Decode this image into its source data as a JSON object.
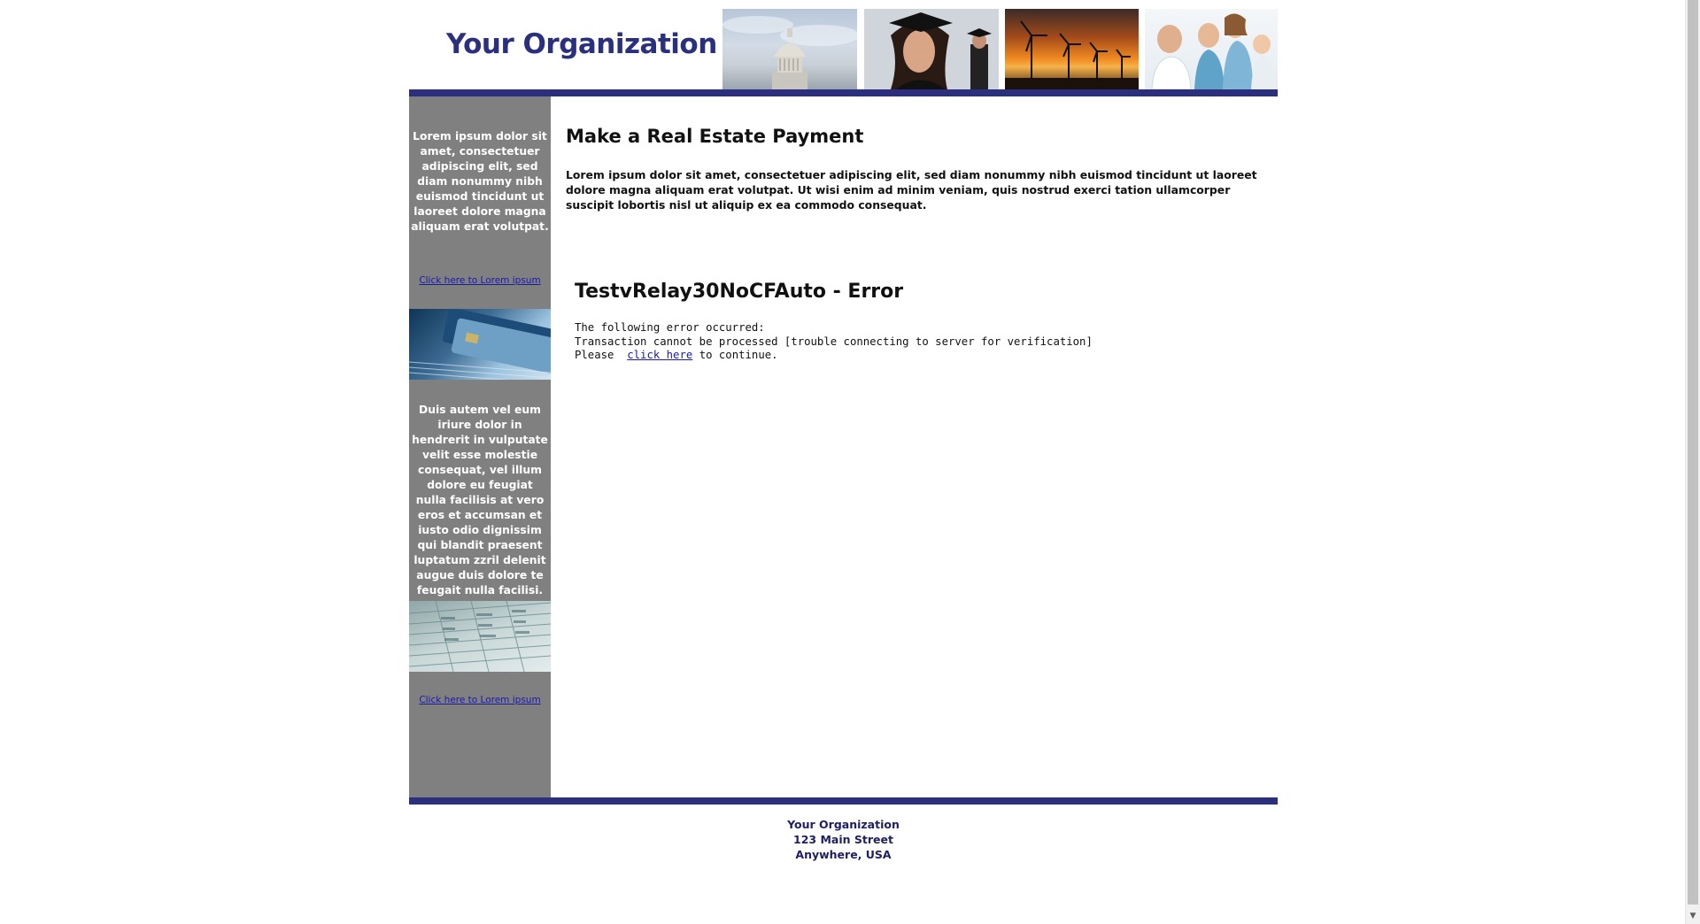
{
  "header": {
    "logo_text": "Your Organization",
    "photos": [
      "capitol-building-photo",
      "graduate-photo",
      "wind-turbines-photo",
      "family-doctor-photo"
    ]
  },
  "sidebar": {
    "text_1": "Lorem ipsum dolor sit amet, consectetuer adipiscing elit, sed diam nonummy nibh euismod tincidunt ut laoreet dolore magna aliquam erat volutpat.",
    "link_1": "Click here to Lorem ipsum",
    "text_2": "Duis autem vel eum iriure dolor in hendrerit in vulputate velit esse molestie consequat, vel illum dolore eu feugiat nulla facilisis at vero eros et accumsan et iusto odio dignissim qui blandit praesent luptatum zzril delenit augue duis dolore te feugait nulla facilisi.",
    "link_2": "Click here to Lorem ipsum"
  },
  "main": {
    "title": "Make a Real Estate Payment",
    "intro": "Lorem ipsum dolor sit amet, consectetuer adipiscing elit, sed diam nonummy nibh euismod tincidunt ut laoreet dolore magna aliquam erat volutpat. Ut wisi enim ad minim veniam, quis nostrud exerci tation ullamcorper suscipit lobortis nisl ut aliquip ex ea commodo consequat.",
    "error_title": "TestvRelay30NoCFAuto - Error",
    "error_line_1": "The following error occurred:",
    "error_line_2": "Transaction cannot be processed [trouble connecting to server for verification]",
    "error_please": "Please",
    "error_link": "click here",
    "error_continue": "to continue."
  },
  "footer": {
    "line_1": "Your Organization",
    "line_2": "123 Main Street",
    "line_3": "Anywhere, USA"
  },
  "colors": {
    "brand_navy": "#2b2f7d",
    "sidebar_gray": "#808080",
    "link_blue": "#1a1aa8"
  }
}
